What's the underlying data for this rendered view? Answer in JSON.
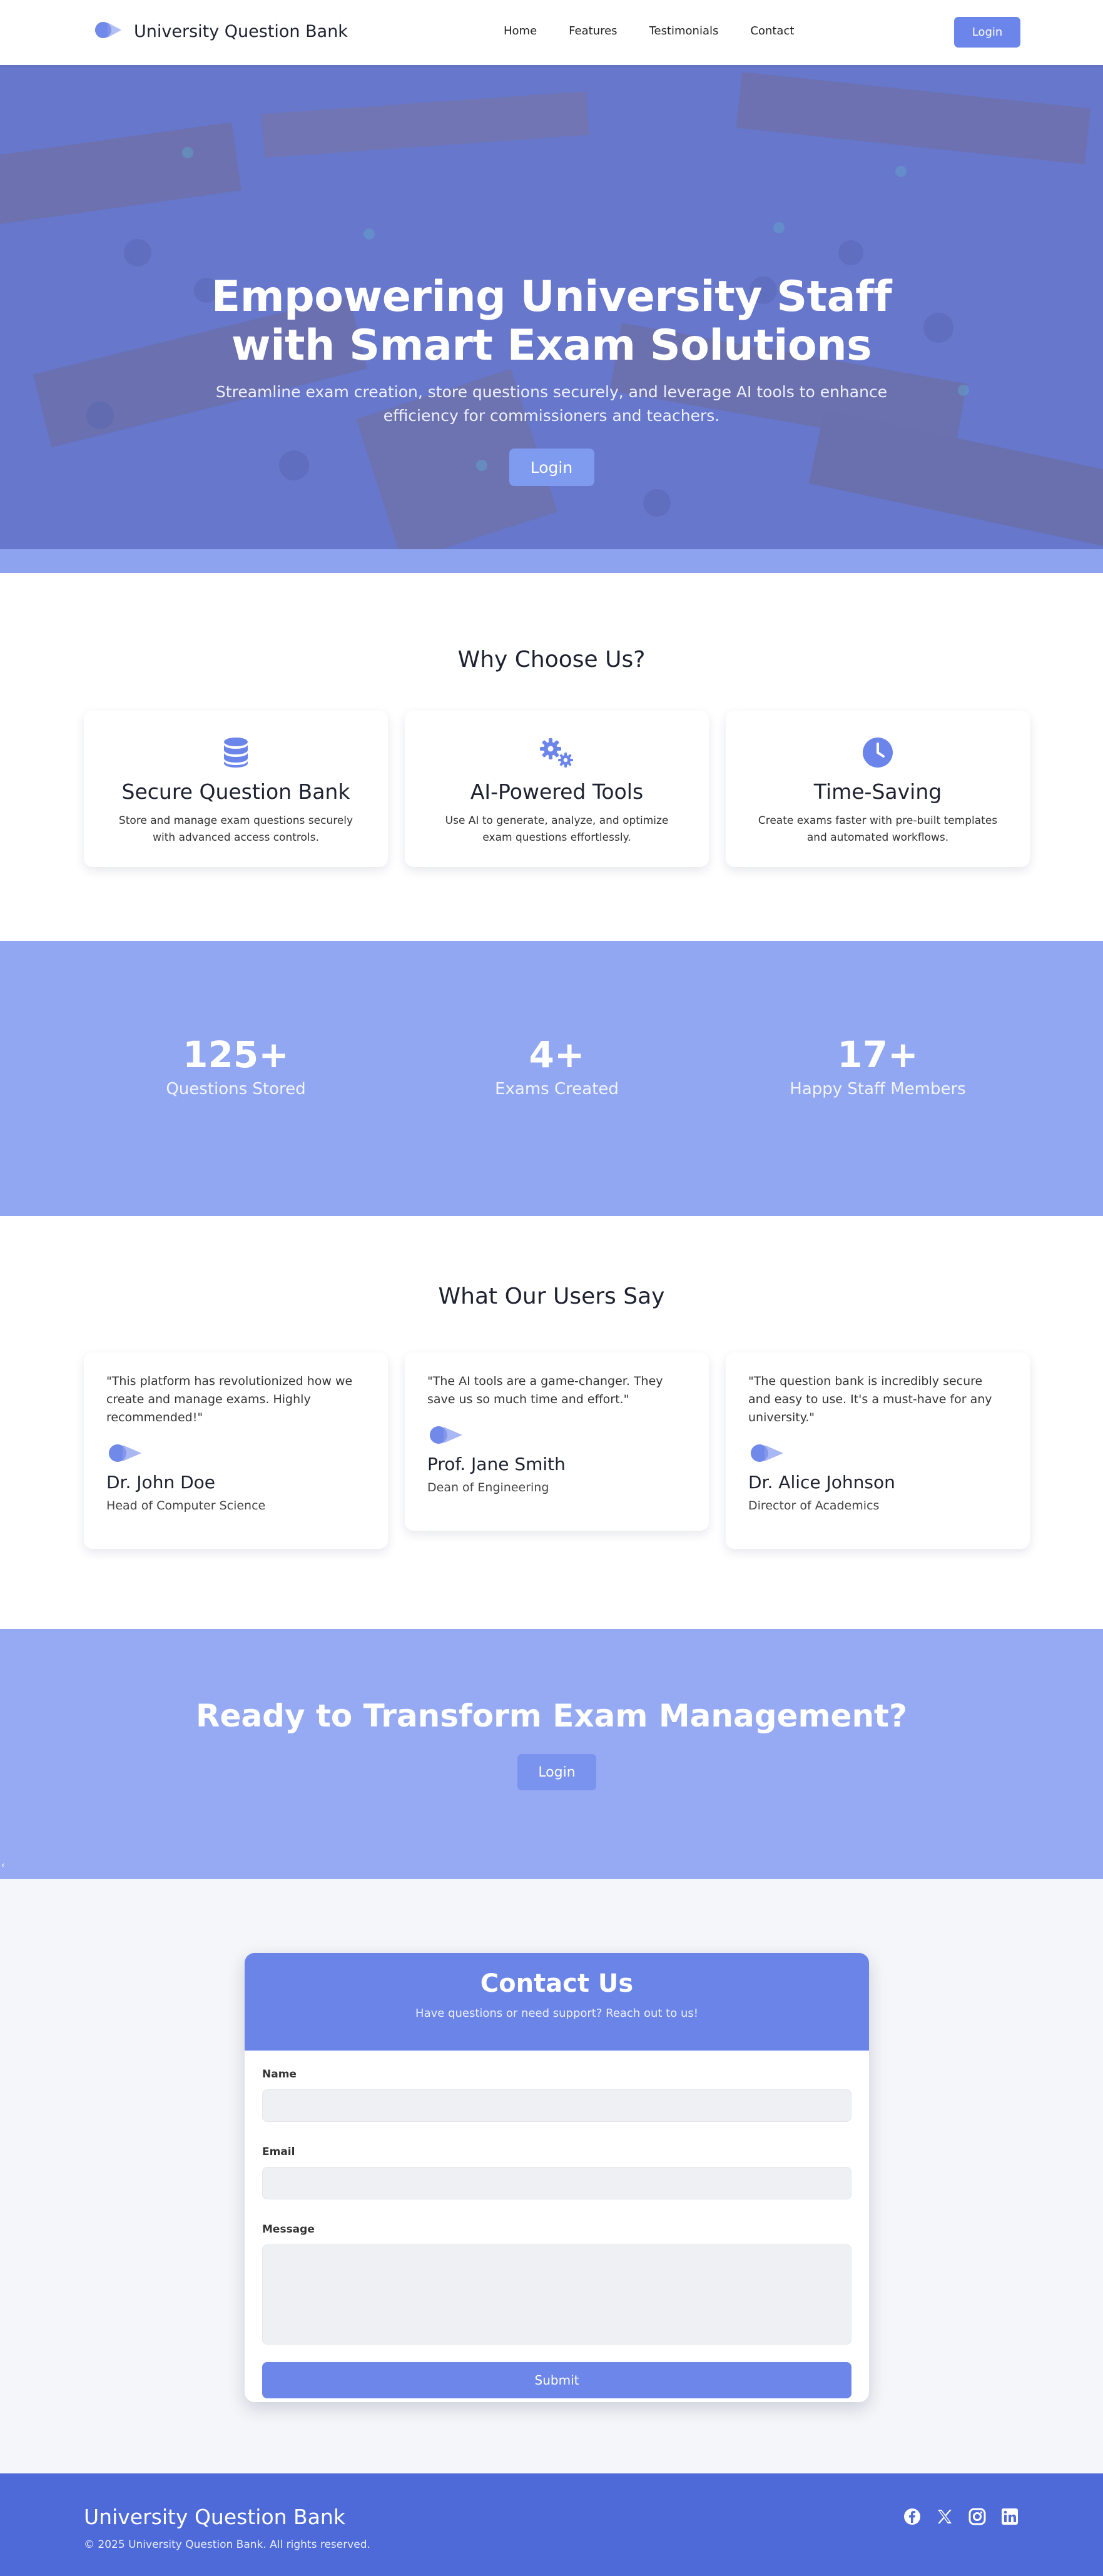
{
  "navbar": {
    "brand": "University Question Bank",
    "links": [
      "Home",
      "Features",
      "Testimonials",
      "Contact"
    ],
    "login_label": "Login"
  },
  "hero": {
    "title_line1": "Empowering University Staff",
    "title_line2": "with Smart Exam Solutions",
    "subtitle_line1": "Streamline exam creation, store questions securely, and leverage AI tools to enhance",
    "subtitle_line2": "efficiency for commissioners and teachers.",
    "button_label": "Login"
  },
  "why": {
    "title": "Why Choose Us?",
    "features": [
      {
        "icon": "database-icon",
        "title": "Secure Question Bank",
        "desc": "Store and manage exam questions securely with advanced access controls."
      },
      {
        "icon": "gears-icon",
        "title": "AI-Powered Tools",
        "desc": "Use AI to generate, analyze, and optimize exam questions effortlessly."
      },
      {
        "icon": "clock-icon",
        "title": "Time-Saving",
        "desc": "Create exams faster with pre-built templates and automated workflows."
      }
    ]
  },
  "stats": [
    {
      "value": "125+",
      "label": "Questions Stored"
    },
    {
      "value": "4+",
      "label": "Exams Created"
    },
    {
      "value": "17+",
      "label": "Happy Staff Members"
    }
  ],
  "testimonials": {
    "title": "What Our Users Say",
    "items": [
      {
        "quote": "\"This platform has revolutionized how we create and manage exams. Highly recommended!\"",
        "name": "Dr. John Doe",
        "role": "Head of Computer Science"
      },
      {
        "quote": "\"The AI tools are a game-changer. They save us so much time and effort.\"",
        "name": "Prof. Jane Smith",
        "role": "Dean of Engineering"
      },
      {
        "quote": "\"The question bank is incredibly secure and easy to use. It's a must-have for any university.\"",
        "name": "Dr. Alice Johnson",
        "role": "Director of Academics"
      }
    ]
  },
  "cta": {
    "title": "Ready to Transform Exam Management?",
    "button_label": "Login",
    "arrow": "‹"
  },
  "contact": {
    "title": "Contact Us",
    "subtitle": "Have questions or need support? Reach out to us!",
    "name_label": "Name",
    "email_label": "Email",
    "message_label": "Message",
    "submit_label": "Submit"
  },
  "footer": {
    "brand": "University Question Bank",
    "copyright": "© 2025 University Question Bank. All rights reserved.",
    "socials": [
      "facebook-icon",
      "x-icon",
      "instagram-icon",
      "linkedin-icon"
    ]
  },
  "colors": {
    "accent": "#6b85ea",
    "stats_bg": "#91a7f1",
    "footer_bg": "#4d6ad8"
  }
}
